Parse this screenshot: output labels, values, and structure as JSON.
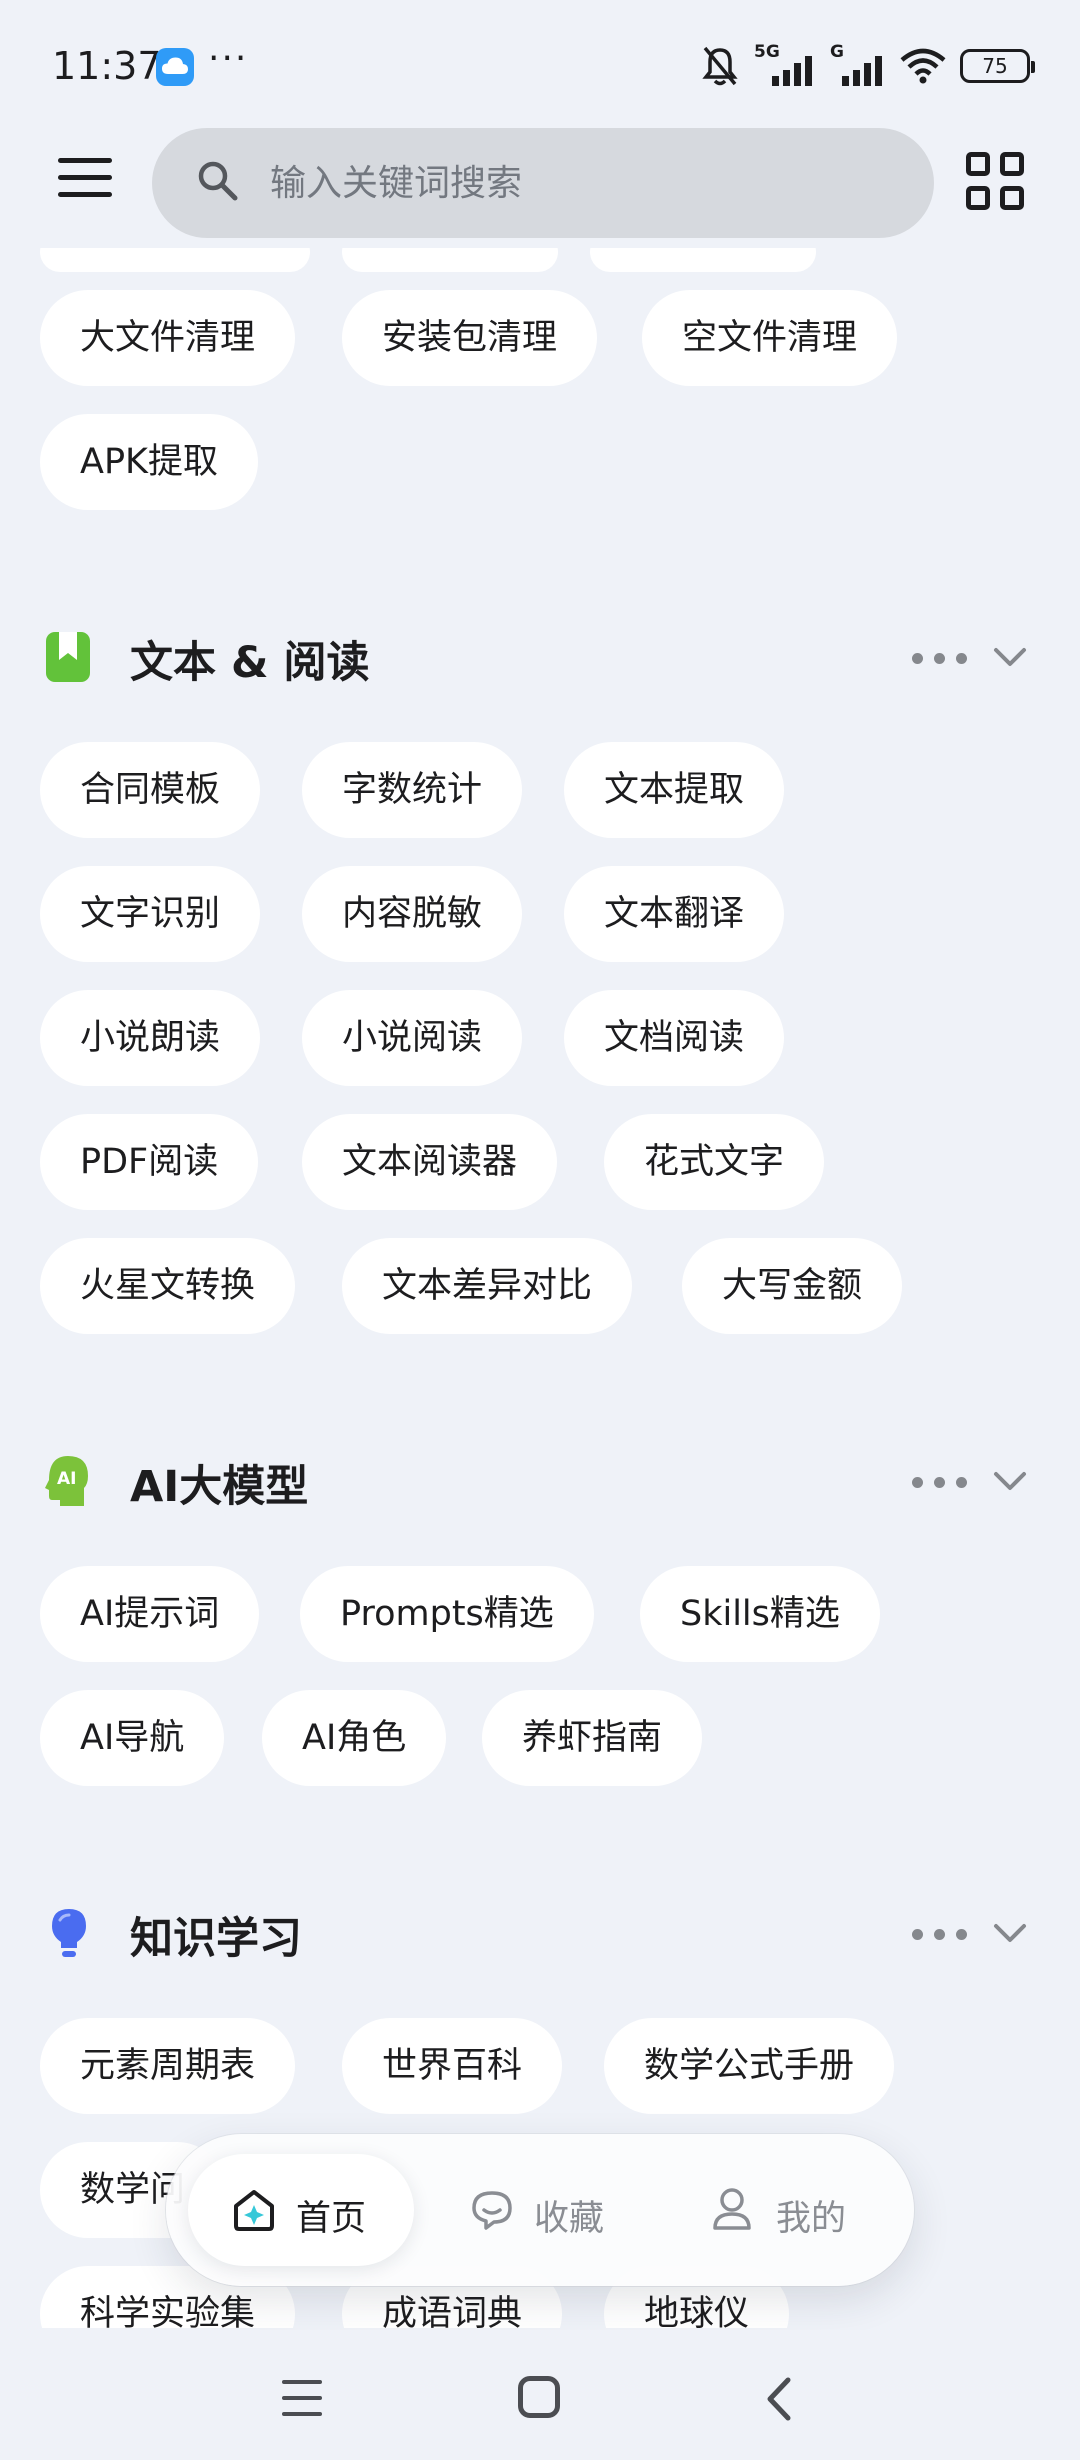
{
  "status_bar": {
    "time": "11:37",
    "dots": "···",
    "network_5g": "5G",
    "network_g": "G",
    "battery": "75"
  },
  "header": {
    "search_placeholder": "输入关键词搜索"
  },
  "top_partial_chips": [
    "",
    "",
    ""
  ],
  "file_section": {
    "chips": [
      "大文件清理",
      "安装包清理",
      "空文件清理",
      "APK提取"
    ]
  },
  "sections": [
    {
      "title": "文本 & 阅读",
      "icon": "bookmark-icon",
      "accent": "#62c23a",
      "chips": [
        "合同模板",
        "字数统计",
        "文本提取",
        "文字识别",
        "内容脱敏",
        "文本翻译",
        "小说朗读",
        "小说阅读",
        "文档阅读",
        "PDF阅读",
        "文本阅读器",
        "花式文字",
        "火星文转换",
        "文本差异对比",
        "大写金额"
      ]
    },
    {
      "title": "AI大模型",
      "icon": "ai-head-icon",
      "accent": "#7cc23a",
      "chips": [
        "AI提示词",
        "Prompts精选",
        "Skills精选",
        "AI导航",
        "AI角色",
        "养虾指南"
      ]
    },
    {
      "title": "知识学习",
      "icon": "lightbulb-icon",
      "accent": "#4a6cf0",
      "chips": [
        "元素周期表",
        "世界百科",
        "数学公式手册",
        "数学问",
        "科学实验集",
        "成语词典",
        "地球仪"
      ]
    }
  ],
  "bottom_nav": {
    "home": "首页",
    "favorites": "收藏",
    "mine": "我的"
  }
}
